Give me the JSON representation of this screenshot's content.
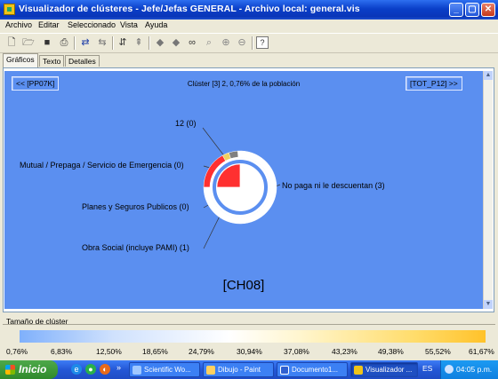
{
  "window": {
    "title": "Visualizador de clústeres - Jefe/Jefas GENERAL - Archivo local: general.vis",
    "min_glyph": "_",
    "max_glyph": "▢",
    "close_glyph": "✕"
  },
  "menu": [
    "Archivo",
    "Editar",
    "Seleccionado",
    "Vista",
    "Ayuda"
  ],
  "toolbar_icons": [
    "new-file-icon",
    "open-folder-icon",
    "save-icon",
    "print-icon",
    "redo-icon",
    "undo-icon",
    "sort-icon",
    "align-icon",
    "arrow-left-icon",
    "arrow-right-icon",
    "binoculars-icon",
    "find-replace-icon",
    "zoom-in-icon",
    "zoom-out-icon",
    "help-icon"
  ],
  "tabs": [
    "Gráficos",
    "Texto",
    "Detalles"
  ],
  "chart": {
    "prev_button": "<< [PP07K]",
    "next_button": "[TOT_P12] >>",
    "cluster_title": "Clúster [3] 2, 0,76% de la población",
    "code": "[CH08]",
    "background": "#5b8ff0"
  },
  "chart_data": {
    "type": "pie",
    "title": "Clúster [3] 2, 0,76% de la población",
    "slices": [
      {
        "label": "12 (0)",
        "value": 0,
        "color": "#c0c0c0"
      },
      {
        "label": "Mutual / Prepaga / Servicio de Emergencia (0)",
        "value": 0,
        "color": "#f0f060"
      },
      {
        "label": "Planes y Seguros Publicos (0)",
        "value": 0,
        "color": "#40a040"
      },
      {
        "label": "Obra Social (incluye PAMI) (1)",
        "value": 1,
        "color": "#ff3030"
      },
      {
        "label": "No paga ni le descuentan (3)",
        "value": 3,
        "color": "#ffffff"
      }
    ],
    "outer_ring_fractions": [
      {
        "color": "#ff3030",
        "fraction": 0.17
      },
      {
        "color": "#f0d060",
        "fraction": 0.03
      },
      {
        "color": "#808080",
        "fraction": 0.04
      },
      {
        "color": "#ffffff",
        "fraction": 0.76
      }
    ],
    "inner_slices_fractions": [
      {
        "color": "#ff3030",
        "fraction": 0.25
      },
      {
        "color": "#ffffff",
        "fraction": 0.75
      }
    ]
  },
  "size_legend": {
    "caption": "Tamaño de clúster",
    "ticks": [
      "0,76%",
      "6,83%",
      "12,50%",
      "18,65%",
      "24,79%",
      "30,94%",
      "37,08%",
      "43,23%",
      "49,38%",
      "55,52%",
      "61,67%"
    ]
  },
  "taskbar": {
    "start": "Inicio",
    "tasks": [
      {
        "label": "Scientific Wo...",
        "active": false,
        "color": "#a0c8ff"
      },
      {
        "label": "Dibujo - Paint",
        "active": false,
        "color": "#ffd060"
      },
      {
        "label": "Documento1...",
        "active": false,
        "color": "#3060d0"
      },
      {
        "label": "Visualizador ...",
        "active": true,
        "color": "#f0c419"
      }
    ],
    "lang": "ES",
    "clock": "04:05 p.m."
  }
}
